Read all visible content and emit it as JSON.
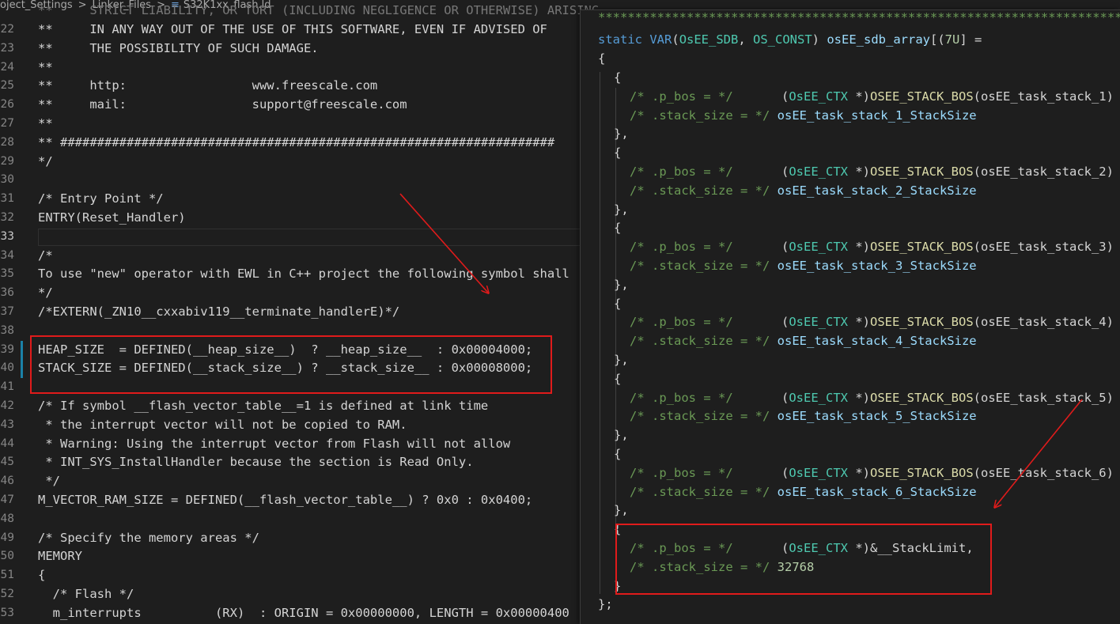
{
  "breadcrumb": {
    "items": [
      "oject_Settings",
      "Linker_Files",
      "S32K1xx_flash.ld"
    ],
    "file_icon": "≡"
  },
  "left_editor": {
    "top_partial": "**     STRICT LIABILITY, OR TORT (INCLUDING NEGLIGENCE OR OTHERWISE) ARISING",
    "lines": [
      {
        "n": "22",
        "text": "**     IN ANY WAY OUT OF THE USE OF THIS SOFTWARE, EVEN IF ADVISED OF"
      },
      {
        "n": "23",
        "text": "**     THE POSSIBILITY OF SUCH DAMAGE."
      },
      {
        "n": "24",
        "text": "**"
      },
      {
        "n": "25",
        "text": "**     http:                 www.freescale.com"
      },
      {
        "n": "26",
        "text": "**     mail:                 support@freescale.com"
      },
      {
        "n": "27",
        "text": "**"
      },
      {
        "n": "28",
        "text": "** ###################################################################"
      },
      {
        "n": "29",
        "text": "*/"
      },
      {
        "n": "30",
        "text": ""
      },
      {
        "n": "31",
        "text": "/* Entry Point */"
      },
      {
        "n": "32",
        "text": "ENTRY(Reset_Handler)"
      },
      {
        "n": "33",
        "text": ""
      },
      {
        "n": "34",
        "text": "/*"
      },
      {
        "n": "35",
        "text": "To use \"new\" operator with EWL in C++ project the following symbol shall"
      },
      {
        "n": "36",
        "text": "*/"
      },
      {
        "n": "37",
        "text": "/*EXTERN(_ZN10__cxxabiv119__terminate_handlerE)*/"
      },
      {
        "n": "38",
        "text": ""
      },
      {
        "n": "39",
        "text": "HEAP_SIZE  = DEFINED(__heap_size__)  ? __heap_size__  : 0x00004000;"
      },
      {
        "n": "40",
        "text": "STACK_SIZE = DEFINED(__stack_size__) ? __stack_size__ : 0x00008000;"
      },
      {
        "n": "41",
        "text": ""
      },
      {
        "n": "42",
        "text": "/* If symbol __flash_vector_table__=1 is defined at link time"
      },
      {
        "n": "43",
        "text": " * the interrupt vector will not be copied to RAM."
      },
      {
        "n": "44",
        "text": " * Warning: Using the interrupt vector from Flash will not allow"
      },
      {
        "n": "45",
        "text": " * INT_SYS_InstallHandler because the section is Read Only."
      },
      {
        "n": "46",
        "text": " */"
      },
      {
        "n": "47",
        "text": "M_VECTOR_RAM_SIZE = DEFINED(__flash_vector_table__) ? 0x0 : 0x0400;"
      },
      {
        "n": "48",
        "text": ""
      },
      {
        "n": "49",
        "text": "/* Specify the memory areas */"
      },
      {
        "n": "50",
        "text": "MEMORY"
      },
      {
        "n": "51",
        "text": "{"
      },
      {
        "n": "52",
        "text": "  /* Flash */"
      },
      {
        "n": "53",
        "text": "  m_interrupts          (RX)  : ORIGIN = 0x00000000, LENGTH = 0x00000400"
      }
    ]
  },
  "right_peek": {
    "top_stars": "*****************************************************************************",
    "declaration": {
      "kw_static": "static",
      "macro": "VAR",
      "arg1": "OsEE_SDB",
      "arg2": "OS_CONST",
      "name": "osEE_sdb_array",
      "size": "7U",
      "tail": "] ="
    },
    "open_brace": "{",
    "close_brace": "};",
    "entry_open": "{",
    "entry_close": "},",
    "bos_comment": "/* .p_bos = */",
    "size_comment": "/* .stack_size = */",
    "ctx_type": "OsEE_CTX",
    "bos_macro": "OSEE_STACK_BOS",
    "entries": [
      {
        "bos_arg": "osEE_task_stack_1)",
        "size": "osEE_task_stack_1_StackSize"
      },
      {
        "bos_arg": "osEE_task_stack_2)",
        "size": "osEE_task_stack_2_StackSize"
      },
      {
        "bos_arg": "osEE_task_stack_3)",
        "size": "osEE_task_stack_3_StackSize"
      },
      {
        "bos_arg": "osEE_task_stack_4)",
        "size": "osEE_task_stack_4_StackSize"
      },
      {
        "bos_arg": "osEE_task_stack_5)",
        "size": "osEE_task_stack_5_StackSize"
      },
      {
        "bos_arg": "osEE_task_stack_6)",
        "size": "osEE_task_stack_6_StackSize"
      }
    ],
    "last_entry": {
      "bos_value": "&__StackLimit,",
      "size_value": "32768"
    }
  },
  "colors": {
    "annotation_red": "#e01b1b",
    "comment_green": "#6a9955",
    "keyword_blue": "#569cd6",
    "type_teal": "#4ec9b0",
    "function_yellow": "#dcdcaa"
  }
}
